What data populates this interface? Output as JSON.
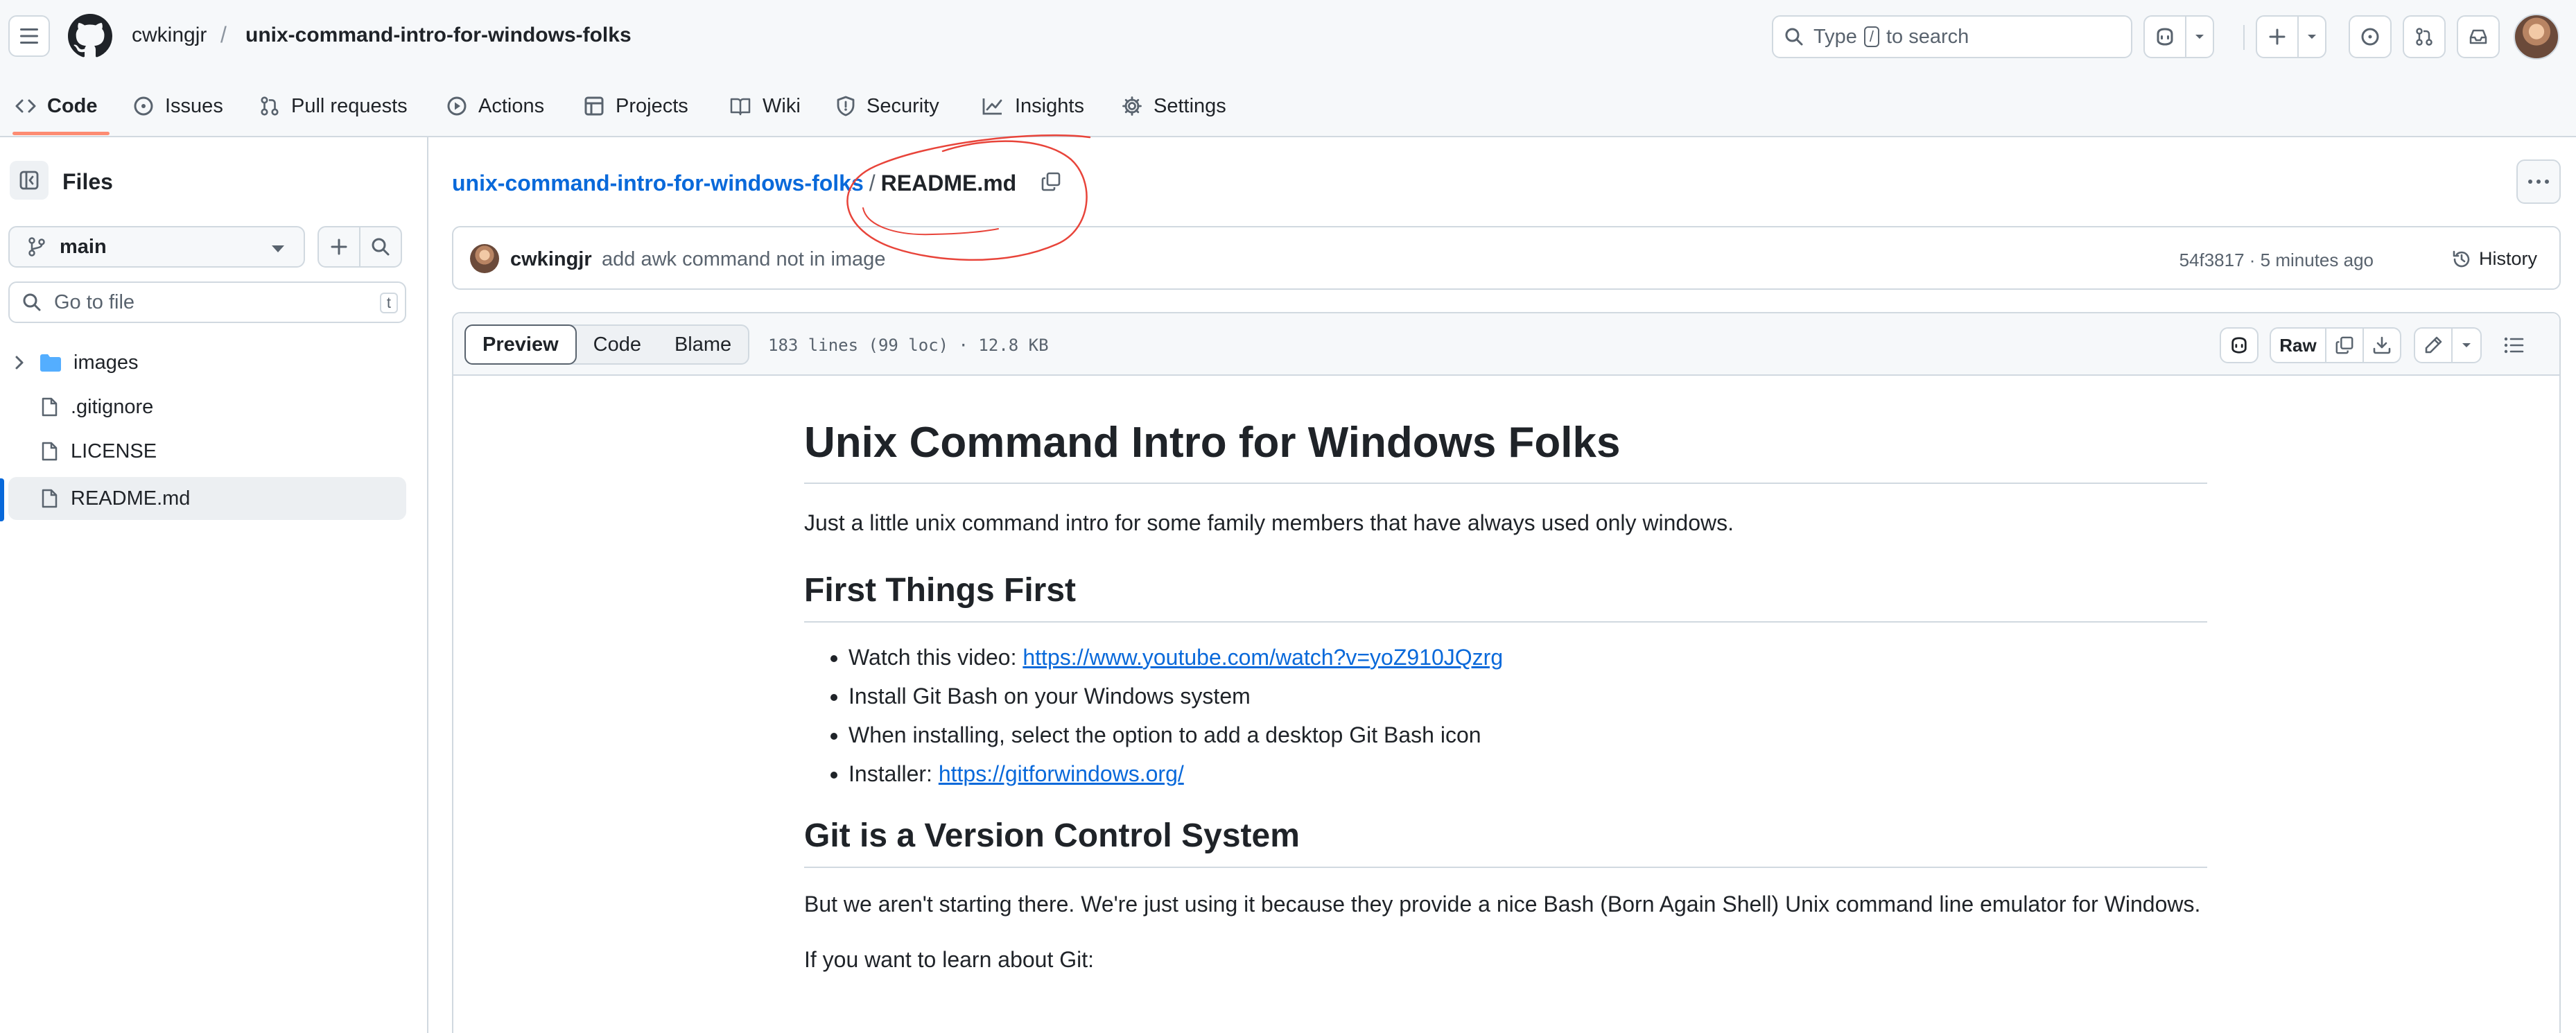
{
  "header": {
    "owner": "cwkingjr",
    "slash": "/",
    "repo": "unix-command-intro-for-windows-folks",
    "search_prefix": "Type",
    "search_key": "/",
    "search_suffix": "to search"
  },
  "nav": {
    "tabs": [
      {
        "label": "Code",
        "icon": "code-icon"
      },
      {
        "label": "Issues",
        "icon": "issue-icon"
      },
      {
        "label": "Pull requests",
        "icon": "pull-request-icon"
      },
      {
        "label": "Actions",
        "icon": "play-icon"
      },
      {
        "label": "Projects",
        "icon": "table-icon"
      },
      {
        "label": "Wiki",
        "icon": "book-icon"
      },
      {
        "label": "Security",
        "icon": "shield-icon"
      },
      {
        "label": "Insights",
        "icon": "graph-icon"
      },
      {
        "label": "Settings",
        "icon": "gear-icon"
      }
    ],
    "active_tab": "Code"
  },
  "sidebar": {
    "title": "Files",
    "branch": "main",
    "goto_placeholder": "Go to file",
    "goto_key": "t",
    "tree": [
      {
        "name": "images",
        "type": "folder"
      },
      {
        "name": ".gitignore",
        "type": "file"
      },
      {
        "name": "LICENSE",
        "type": "file"
      },
      {
        "name": "README.md",
        "type": "file",
        "selected": true
      }
    ]
  },
  "file": {
    "repo_link": "unix-command-intro-for-windows-folks",
    "sep": "/",
    "name": "README.md",
    "commit_author": "cwkingjr",
    "commit_message": "add awk command not in image",
    "commit_meta": "54f3817 · 5 minutes ago",
    "history_label": "History",
    "view_tabs": [
      "Preview",
      "Code",
      "Blame"
    ],
    "active_view": "Preview",
    "info": "183 lines (99 loc) · 12.8 KB",
    "raw_label": "Raw"
  },
  "readme": {
    "h1": "Unix Command Intro for Windows Folks",
    "intro": "Just a little unix command intro for some family members that have always used only windows.",
    "h2_first": "First Things First",
    "li1_prefix": "Watch this video: ",
    "li1_link": "https://www.youtube.com/watch?v=yoZ910JQzrg",
    "li2": "Install Git Bash on your Windows system",
    "li3": "When installing, select the option to add a desktop Git Bash icon",
    "li4_prefix": "Installer: ",
    "li4_link": "https://gitforwindows.org/",
    "h2_git": "Git is a Version Control System",
    "git_para": "But we aren't starting there. We're just using it because they provide a nice Bash (Born Again Shell) Unix command line emulator for Windows.",
    "learn_git": "If you want to learn about Git:"
  },
  "colors": {
    "link": "#0969da",
    "tab_underline": "#fd8c73",
    "annotation": "#e8443a"
  }
}
